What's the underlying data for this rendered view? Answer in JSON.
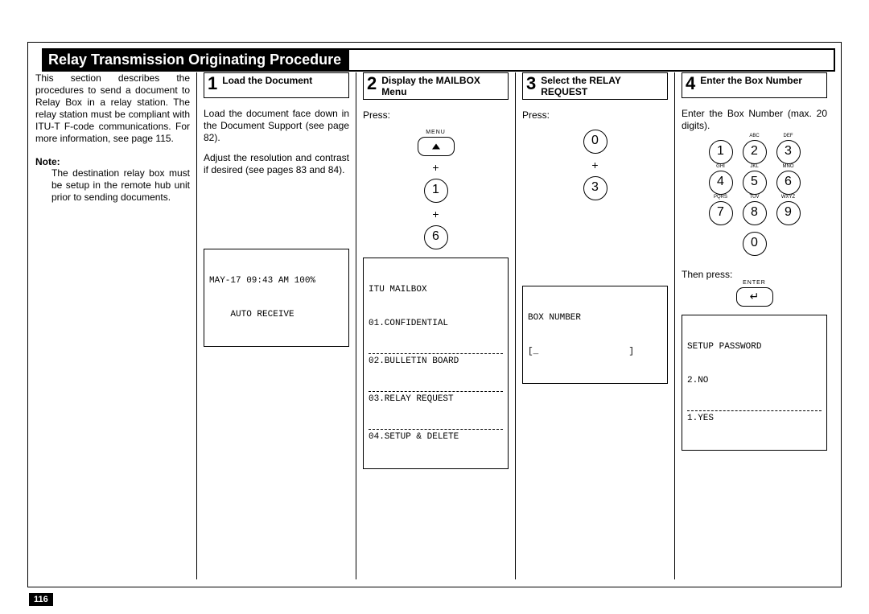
{
  "title": "Relay Transmission Originating Procedure",
  "page_number": "116",
  "intro": "This section describes the procedures to send a document to Relay Box in a relay station. The relay station must be compliant with ITU-T F-code communications. For more information, see page 115.",
  "note_label": "Note:",
  "note_body": "The destination relay box must be setup in the remote hub unit prior to sending documents.",
  "step1": {
    "num": "1",
    "title": "Load the Document",
    "p1": "Load the document face down in the Document Support (see page 82).",
    "p2": "Adjust the resolution and contrast if desired (see pages 83 and 84).",
    "lcd_line1": "MAY-17 09:43 AM 100%",
    "lcd_line2": "    AUTO RECEIVE"
  },
  "step2": {
    "num": "2",
    "title": "Display the MAILBOX Menu",
    "press": "Press:",
    "menu_label": "MENU",
    "key1": "1",
    "key2": "6",
    "lcd_line1": "ITU MAILBOX",
    "lcd_line2": "01.CONFIDENTIAL",
    "lcd_line3": "02.BULLETIN BOARD",
    "lcd_line4": "03.RELAY REQUEST",
    "lcd_line5": "04.SETUP & DELETE"
  },
  "step3": {
    "num": "3",
    "title": "Select the RELAY REQUEST",
    "press": "Press:",
    "key1": "0",
    "key2": "3",
    "lcd_line1": "BOX NUMBER",
    "lcd_line2": "[_                 ]"
  },
  "step4": {
    "num": "4",
    "title": "Enter the Box Number",
    "p1": "Enter the Box Number (max. 20 digits).",
    "keys": [
      "1",
      "2",
      "3",
      "4",
      "5",
      "6",
      "7",
      "8",
      "9",
      "0"
    ],
    "klabels": [
      "",
      "ABC",
      "DEF",
      "GHI",
      "JKL",
      "MNO",
      "PQRS",
      "TUV",
      "WXYZ",
      ""
    ],
    "then": "Then press:",
    "enter_label": "ENTER",
    "enter_glyph": "↵",
    "lcd_line1": "SETUP PASSWORD",
    "lcd_line2": "2.NO",
    "lcd_line3": "1.YES"
  }
}
